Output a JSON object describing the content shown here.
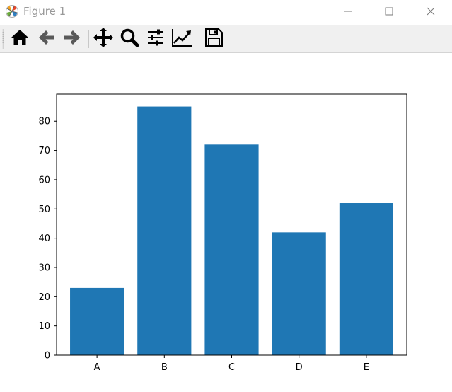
{
  "window": {
    "title": "Figure 1",
    "icon": "matplotlib-logo-icon",
    "controls": [
      "minimize-icon",
      "maximize-icon",
      "close-icon"
    ]
  },
  "toolbar": {
    "buttons": [
      {
        "name": "home",
        "icon": "home-icon"
      },
      {
        "name": "back",
        "icon": "arrow-left-icon"
      },
      {
        "name": "forward",
        "icon": "arrow-right-icon"
      },
      {
        "name": "pan",
        "icon": "move-icon"
      },
      {
        "name": "zoom",
        "icon": "magnifier-icon"
      },
      {
        "name": "configure-subplots",
        "icon": "sliders-icon"
      },
      {
        "name": "edit-axis",
        "icon": "line-chart-icon"
      },
      {
        "name": "save",
        "icon": "floppy-disk-icon"
      }
    ]
  },
  "colors": {
    "bar": "#1f77b4",
    "axes": "#000000",
    "toolbar_bg": "#f0f0f0"
  },
  "chart_data": {
    "type": "bar",
    "categories": [
      "A",
      "B",
      "C",
      "D",
      "E"
    ],
    "values": [
      23,
      85,
      72,
      42,
      52
    ],
    "yticks": [
      0,
      10,
      20,
      30,
      40,
      50,
      60,
      70,
      80
    ],
    "ylim": [
      0,
      89.25
    ],
    "grid": false,
    "title": "",
    "xlabel": "",
    "ylabel": ""
  }
}
